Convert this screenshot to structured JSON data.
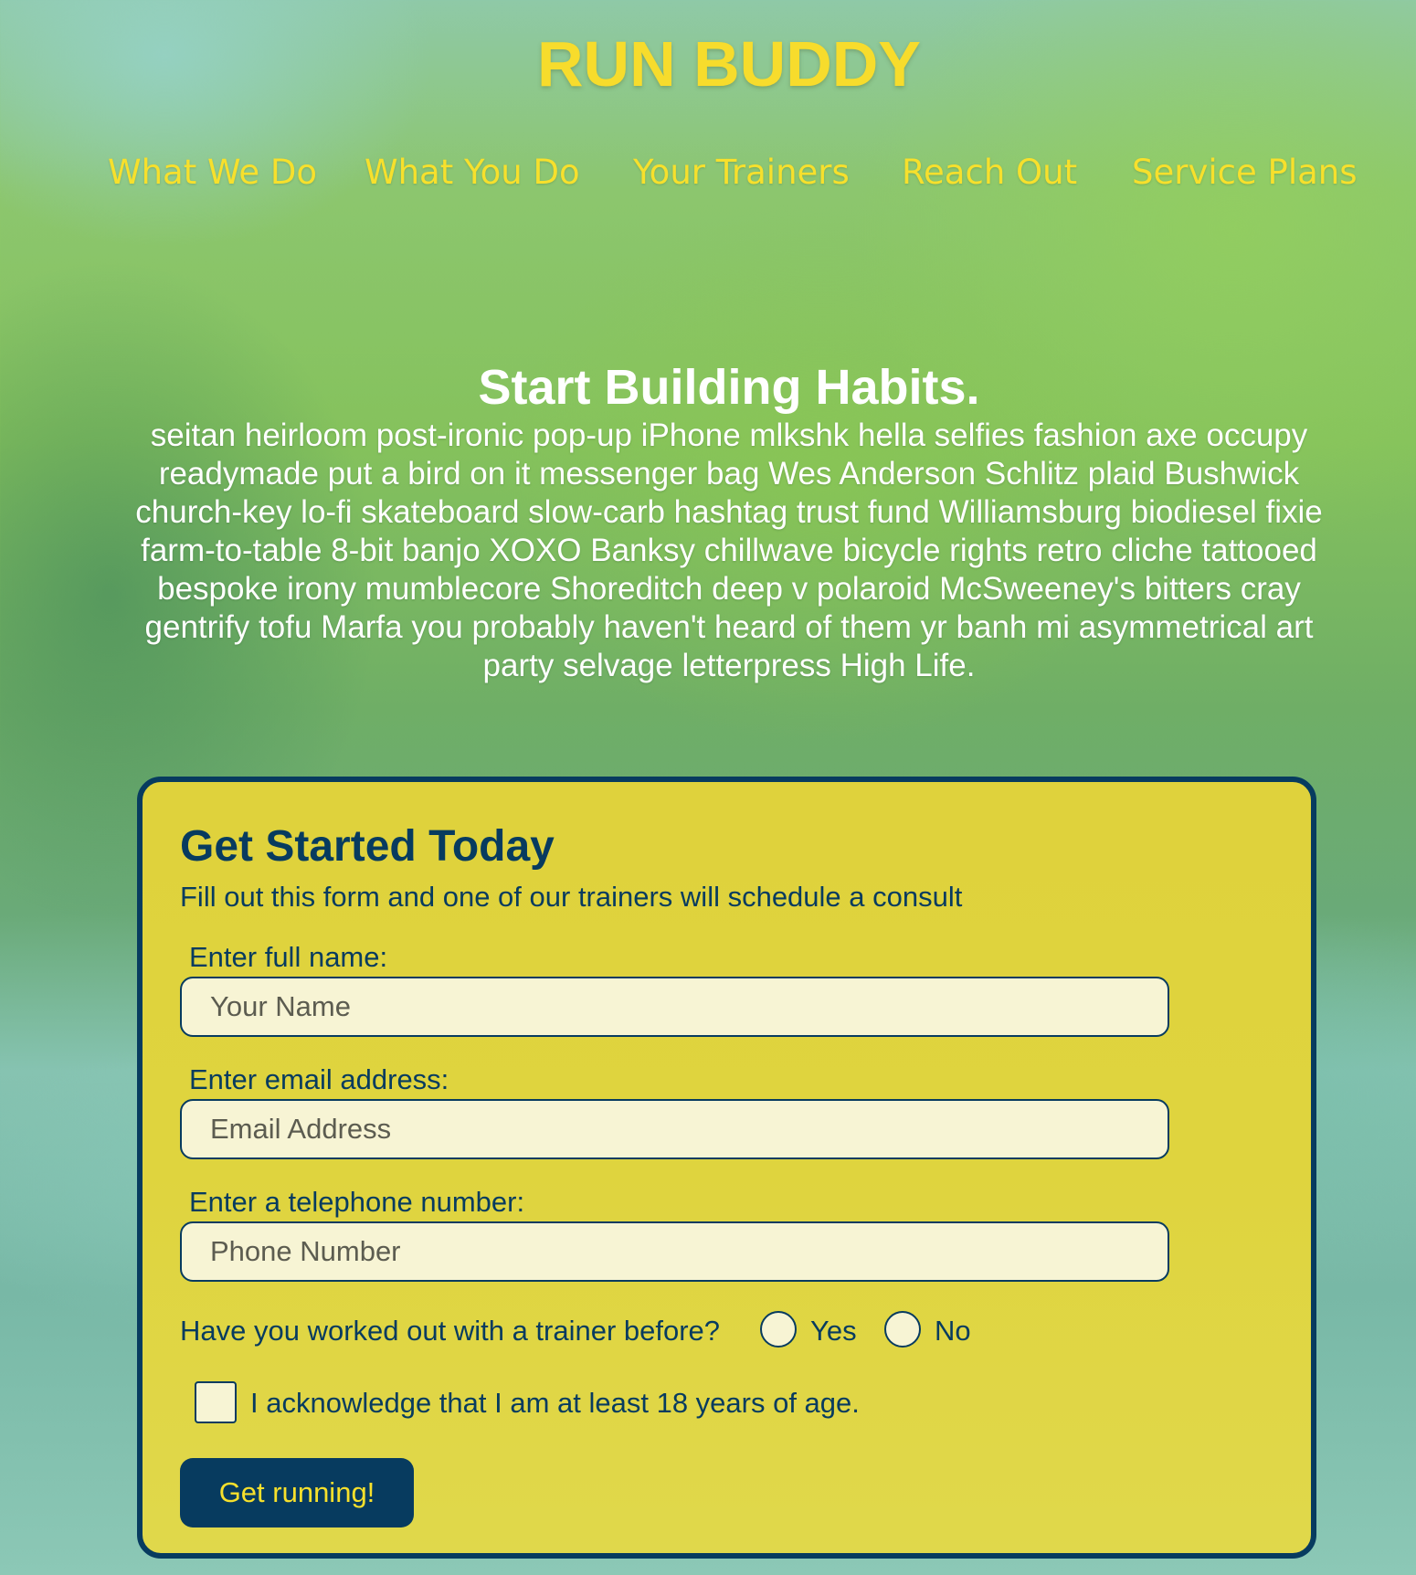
{
  "header": {
    "title": "RUN BUDDY",
    "nav": [
      {
        "label": "What We Do"
      },
      {
        "label": "What You Do"
      },
      {
        "label": "Your Trainers"
      },
      {
        "label": "Reach Out"
      },
      {
        "label": "Service Plans"
      }
    ]
  },
  "hero": {
    "heading": "Start Building Habits.",
    "body": "seitan heirloom post-ironic pop-up iPhone mlkshk hella selfies fashion axe occupy readymade put a bird on it messenger bag Wes Anderson Schlitz plaid Bushwick church-key lo-fi skateboard slow-carb hashtag trust fund Williamsburg biodiesel fixie farm-to-table 8-bit banjo XOXO Banksy chillwave bicycle rights retro cliche tattooed bespoke irony mumblecore Shoreditch deep v polaroid McSweeney's bitters cray gentrify tofu Marfa you probably haven't heard of them yr banh mi asymmetrical art party selvage letterpress High Life."
  },
  "form": {
    "title": "Get Started Today",
    "subtitle": "Fill out this form and one of our trainers will schedule a consult",
    "fields": [
      {
        "label": "Enter full name:",
        "placeholder": "Your Name",
        "value": ""
      },
      {
        "label": "Enter email address:",
        "placeholder": "Email Address",
        "value": ""
      },
      {
        "label": "Enter a telephone number:",
        "placeholder": "Phone Number",
        "value": ""
      }
    ],
    "trainer_question": "Have you worked out with a trainer before?",
    "radio_options": [
      {
        "label": "Yes",
        "selected": false
      },
      {
        "label": "No",
        "selected": false
      }
    ],
    "age_ack": {
      "label": "I acknowledge that I am at least 18 years of age.",
      "checked": false
    },
    "submit_label": "Get running!"
  },
  "colors": {
    "brand_yellow": "#f7dc2c",
    "brand_navy": "#073b5f",
    "form_background": "#dfd43e",
    "input_background": "#f7f4d4"
  }
}
